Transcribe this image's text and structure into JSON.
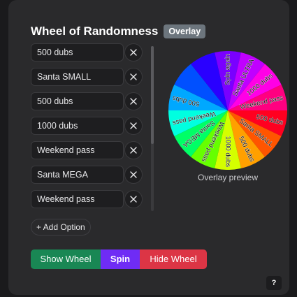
{
  "header": {
    "title": "Wheel of Randomness",
    "badge": "Overlay"
  },
  "options": [
    {
      "value": "500 dubs"
    },
    {
      "value": "Santa SMALL"
    },
    {
      "value": "500 dubs"
    },
    {
      "value": "1000 dubs"
    },
    {
      "value": "Weekend pass"
    },
    {
      "value": "Santa MEGA"
    },
    {
      "value": "Weekend pass"
    }
  ],
  "add_option_label": "+ Add Option",
  "preview_label": "Overlay preview",
  "buttons": {
    "show": "Show Wheel",
    "spin": "Spin",
    "hide": "Hide Wheel"
  },
  "help_label": "?",
  "wheel": {
    "segments": [
      {
        "label": "Spin again",
        "color": "#7a00ff"
      },
      {
        "label": "Santa ULTRA",
        "color": "#c000ff"
      },
      {
        "label": "1000 dubs",
        "color": "#ff00e6"
      },
      {
        "label": "Weekend pass",
        "color": "#ff0080"
      },
      {
        "label": "500 dubs",
        "color": "#ff0020"
      },
      {
        "label": "Santa SMALL",
        "color": "#ff5500"
      },
      {
        "label": "500 dubs",
        "color": "#ffa000"
      },
      {
        "label": "1000 dubs",
        "color": "#d4ff00"
      },
      {
        "label": "Weekend pass",
        "color": "#66ff00"
      },
      {
        "label": "Santa MEGA",
        "color": "#00ff66"
      },
      {
        "label": "Weekend pass",
        "color": "#00ffe0"
      },
      {
        "label": "500 dubs",
        "color": "#00a8ff"
      },
      {
        "label": "",
        "color": "#0050ff"
      },
      {
        "label": "",
        "color": "#2a00ff"
      }
    ]
  }
}
